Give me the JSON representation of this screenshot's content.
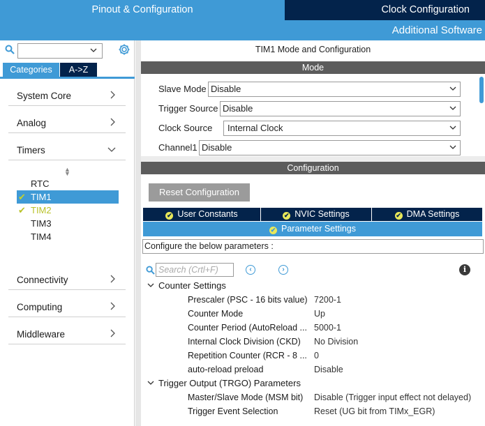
{
  "header": {
    "tab_pinout": "Pinout & Configuration",
    "tab_clock": "Clock Configuration",
    "additional_software": "Additional Software"
  },
  "sidebar": {
    "search_value": "",
    "tab_categories": "Categories",
    "tab_az": "A->Z",
    "categories": [
      "System Core",
      "Analog",
      "Timers",
      "Connectivity",
      "Computing",
      "Middleware"
    ],
    "timers": [
      {
        "label": "RTC",
        "state": "none"
      },
      {
        "label": "TIM1",
        "state": "selected-enabled"
      },
      {
        "label": "TIM2",
        "state": "enabled"
      },
      {
        "label": "TIM3",
        "state": "none"
      },
      {
        "label": "TIM4",
        "state": "none"
      }
    ]
  },
  "mode": {
    "title": "TIM1 Mode and Configuration",
    "header": "Mode",
    "rows": [
      {
        "label": "Slave Mode",
        "value": "Disable"
      },
      {
        "label": "Trigger Source",
        "value": "Disable"
      },
      {
        "label": "Clock Source",
        "value": "Internal Clock"
      },
      {
        "label": "Channel1",
        "value": "Disable"
      }
    ]
  },
  "configuration": {
    "header": "Configuration",
    "reset_button": "Reset Configuration",
    "tabs": [
      "User Constants",
      "NVIC Settings",
      "DMA Settings"
    ],
    "active_tab": "Parameter Settings",
    "configure_text": "Configure the below parameters :",
    "search_placeholder": "Search (Crtl+F)",
    "groups": [
      {
        "name": "Counter Settings",
        "params": [
          {
            "name": "Prescaler (PSC - 16 bits value)",
            "value": "7200-1"
          },
          {
            "name": "Counter Mode",
            "value": "Up"
          },
          {
            "name": "Counter Period (AutoReload ...",
            "value": "5000-1"
          },
          {
            "name": "Internal Clock Division (CKD)",
            "value": "No Division"
          },
          {
            "name": "Repetition Counter (RCR - 8 ...",
            "value": "0"
          },
          {
            "name": "auto-reload preload",
            "value": "Disable"
          }
        ]
      },
      {
        "name": "Trigger Output (TRGO) Parameters",
        "params": [
          {
            "name": "Master/Slave Mode (MSM bit)",
            "value": "Disable (Trigger input effect not delayed)"
          },
          {
            "name": "Trigger Event Selection",
            "value": "Reset (UG bit from TIMx_EGR)"
          }
        ]
      }
    ]
  },
  "colors": {
    "accent": "#3f9ad6",
    "dark": "#03234b",
    "header_gray": "#5c5c5c"
  }
}
